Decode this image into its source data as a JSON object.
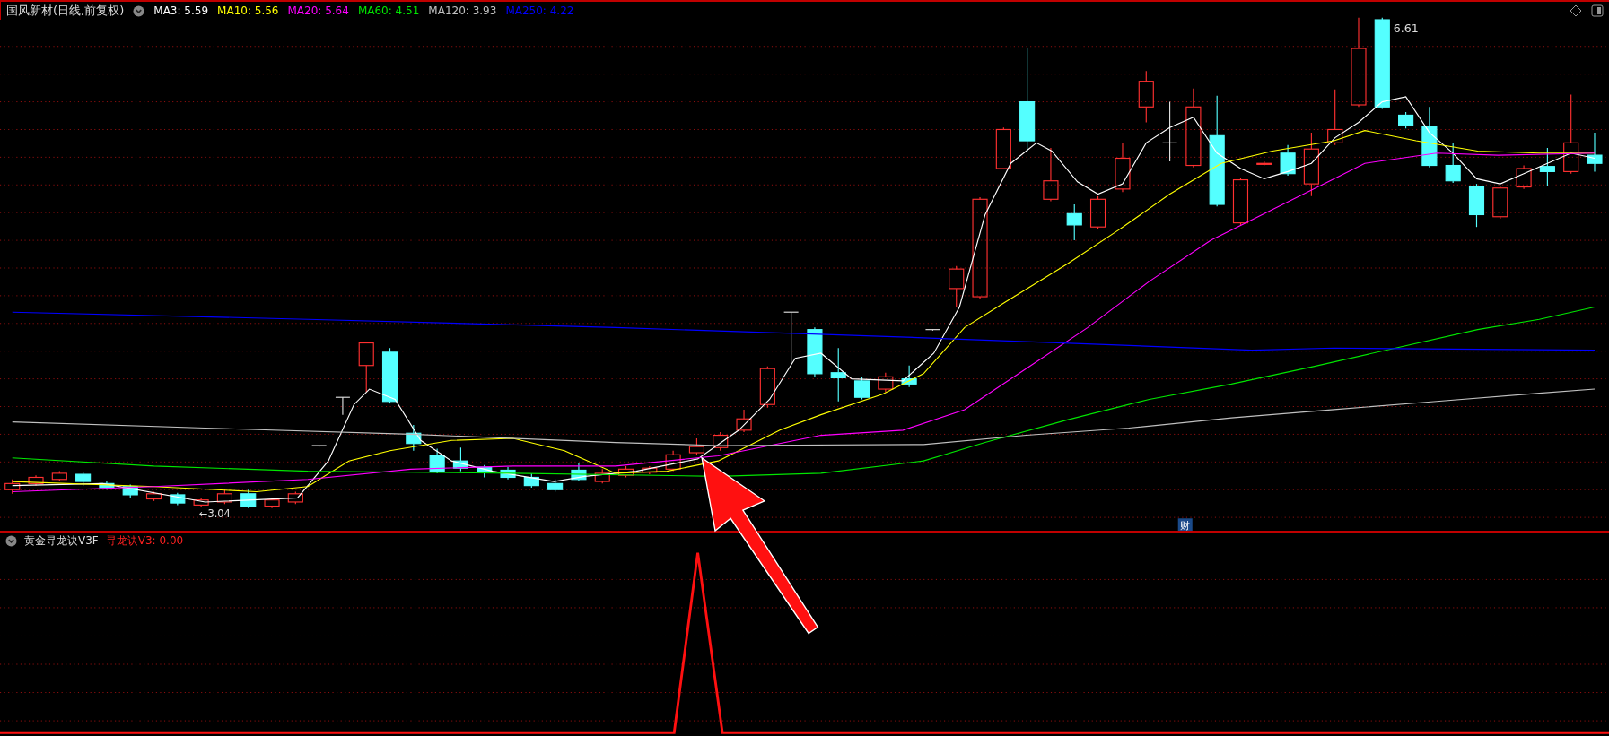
{
  "header": {
    "title": "国风新材(日线,前复权)",
    "ma_legend": [
      {
        "label": "MA3: 5.59",
        "color": "#ffffff"
      },
      {
        "label": "MA10: 5.56",
        "color": "#ffff00"
      },
      {
        "label": "MA20: 5.64",
        "color": "#ff00ff"
      },
      {
        "label": "MA60: 4.51",
        "color": "#00e600"
      },
      {
        "label": "MA120: 3.93",
        "color": "#c0c0c0"
      },
      {
        "label": "MA250: 4.22",
        "color": "#0000ff"
      }
    ]
  },
  "price_chart": {
    "high_label": "6.61",
    "low_label": "←3.04",
    "finance_marker": "财"
  },
  "indicator": {
    "title": "黄金寻龙诀V3F",
    "value_label": "寻龙诀V3: 0.00"
  }
}
